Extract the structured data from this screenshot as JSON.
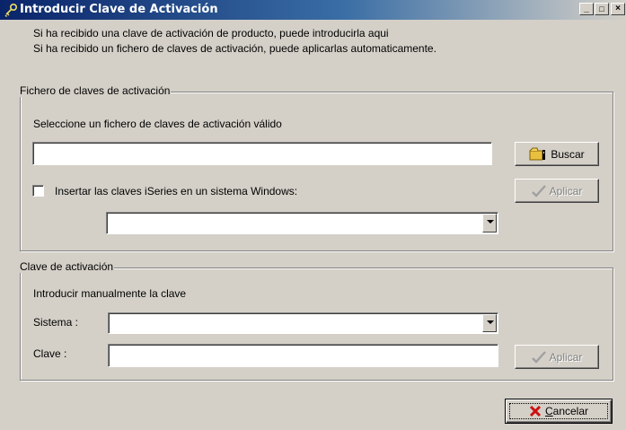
{
  "window": {
    "title": "Introducir Clave de Activación",
    "controls": {
      "minimize": "_",
      "maximize": "□",
      "close": "×"
    }
  },
  "intro": {
    "line1": "Si ha recibido una clave de activación de producto, puede introducirla aqui",
    "line2": "Si ha recibido un fichero de claves de activación, puede aplicarlas automaticamente."
  },
  "file_group": {
    "legend": "Fichero de claves de activación",
    "instruction": "Seleccione un fichero de claves de activación válido",
    "file_path_value": "",
    "browse_label": "Buscar",
    "insert_iseries_label": "Insertar las claves iSeries en un sistema Windows:",
    "insert_iseries_checked": false,
    "apply_label": "Aplicar",
    "system_select_value": ""
  },
  "key_group": {
    "legend": "Clave de activación",
    "instruction": "Introducir manualmente la clave",
    "system_label": "Sistema :",
    "system_value": "",
    "key_label": "Clave :",
    "key_value": "",
    "apply_label": "Aplicar"
  },
  "footer": {
    "cancel_label": "Cancelar",
    "cancel_accel": "C",
    "cancel_rest": "ancelar"
  }
}
